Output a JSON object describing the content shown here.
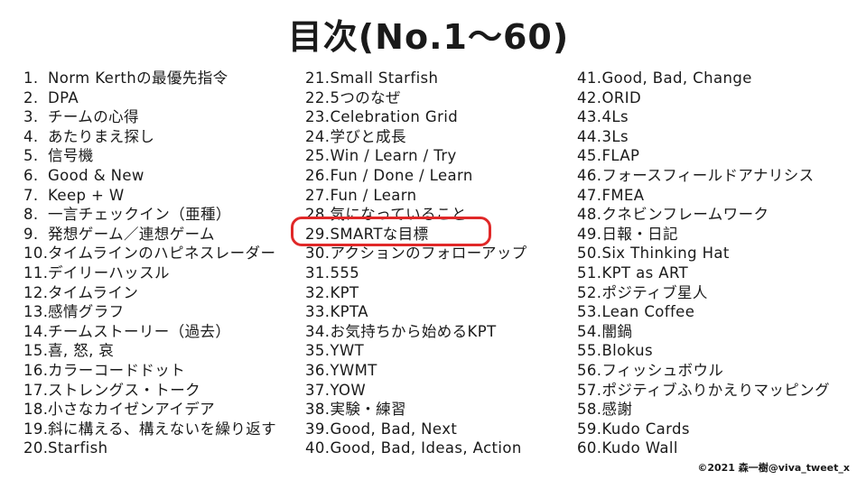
{
  "title": "目次(No.1〜60)",
  "columns": [
    [
      {
        "num": "1.",
        "text": "Norm Kerthの最優先指令"
      },
      {
        "num": "2.",
        "text": "DPA"
      },
      {
        "num": "3.",
        "text": "チームの心得"
      },
      {
        "num": "4.",
        "text": "あたりまえ探し"
      },
      {
        "num": "5.",
        "text": "信号機"
      },
      {
        "num": "6.",
        "text": "Good & New"
      },
      {
        "num": "7.",
        "text": "Keep + W"
      },
      {
        "num": "8.",
        "text": "一言チェックイン（亜種）"
      },
      {
        "num": "9.",
        "text": "発想ゲーム／連想ゲーム"
      },
      {
        "num": "10.",
        "text": "タイムラインのハピネスレーダー"
      },
      {
        "num": "11.",
        "text": "デイリーハッスル"
      },
      {
        "num": "12.",
        "text": "タイムライン"
      },
      {
        "num": "13.",
        "text": "感情グラフ"
      },
      {
        "num": "14.",
        "text": "チームストーリー（過去）"
      },
      {
        "num": "15.",
        "text": "喜, 怒, 哀"
      },
      {
        "num": "16.",
        "text": "カラーコードドット"
      },
      {
        "num": "17.",
        "text": "ストレングス・トーク"
      },
      {
        "num": "18.",
        "text": "小さなカイゼンアイデア"
      },
      {
        "num": "19.",
        "text": "斜に構える、構えないを繰り返す"
      },
      {
        "num": "20.",
        "text": "Starfish"
      }
    ],
    [
      {
        "num": "21.",
        "text": "Small Starfish"
      },
      {
        "num": "22.",
        "text": "5つのなぜ"
      },
      {
        "num": "23.",
        "text": "Celebration Grid"
      },
      {
        "num": "24.",
        "text": "学びと成長"
      },
      {
        "num": "25.",
        "text": "Win / Learn / Try"
      },
      {
        "num": "26.",
        "text": "Fun / Done / Learn"
      },
      {
        "num": "27.",
        "text": "Fun / Learn"
      },
      {
        "num": "28.",
        "text": "気になっていること"
      },
      {
        "num": "29.",
        "text": "SMARTな目標"
      },
      {
        "num": "30.",
        "text": "アクションのフォローアップ"
      },
      {
        "num": "31.",
        "text": "555"
      },
      {
        "num": "32.",
        "text": "KPT"
      },
      {
        "num": "33.",
        "text": "KPTA"
      },
      {
        "num": "34.",
        "text": "お気持ちから始めるKPT"
      },
      {
        "num": "35.",
        "text": "YWT"
      },
      {
        "num": "36.",
        "text": "YWMT"
      },
      {
        "num": "37.",
        "text": "YOW"
      },
      {
        "num": "38.",
        "text": "実験・練習"
      },
      {
        "num": "39.",
        "text": "Good, Bad, Next"
      },
      {
        "num": "40.",
        "text": "Good, Bad, Ideas, Action"
      }
    ],
    [
      {
        "num": "41.",
        "text": "Good, Bad, Change"
      },
      {
        "num": "42.",
        "text": "ORID"
      },
      {
        "num": "43.",
        "text": "4Ls"
      },
      {
        "num": "44.",
        "text": "3Ls"
      },
      {
        "num": "45.",
        "text": "FLAP"
      },
      {
        "num": "46.",
        "text": "フォースフィールドアナリシス"
      },
      {
        "num": "47.",
        "text": "FMEA"
      },
      {
        "num": "48.",
        "text": "クネビンフレームワーク"
      },
      {
        "num": "49.",
        "text": "日報・日記"
      },
      {
        "num": "50.",
        "text": "Six Thinking Hat"
      },
      {
        "num": "51.",
        "text": "KPT as ART"
      },
      {
        "num": "52.",
        "text": "ポジティブ星人"
      },
      {
        "num": "53.",
        "text": "Lean Coffee"
      },
      {
        "num": "54.",
        "text": "闇鍋"
      },
      {
        "num": "55.",
        "text": "Blokus"
      },
      {
        "num": "56.",
        "text": "フィッシュボウル"
      },
      {
        "num": "57.",
        "text": "ポジティブふりかえりマッピング"
      },
      {
        "num": "58.",
        "text": "感謝"
      },
      {
        "num": "59.",
        "text": "Kudo Cards"
      },
      {
        "num": "60.",
        "text": "Kudo Wall"
      }
    ]
  ],
  "highlight_item": "29",
  "highlight_color": "#e02828",
  "credit": "©2021 森一樹@viva_tweet_x"
}
